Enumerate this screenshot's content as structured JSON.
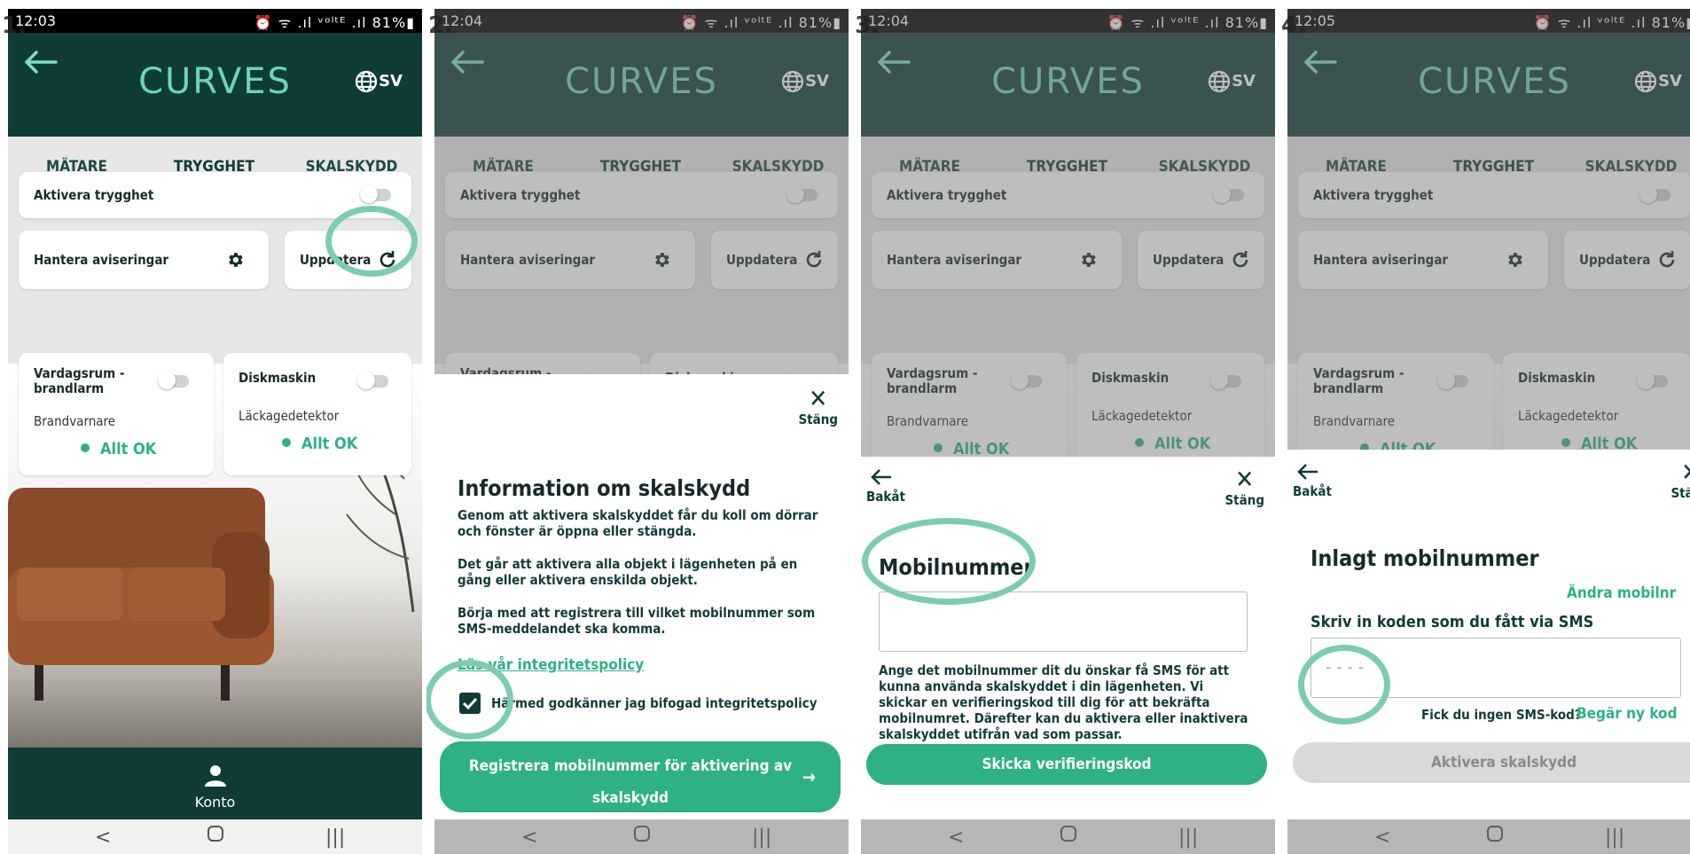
{
  "steps": [
    {
      "number": "1.",
      "time": "12:03"
    },
    {
      "number": "2.",
      "time": "12:04"
    },
    {
      "number": "3.",
      "time": "12:04"
    },
    {
      "number": "4.",
      "time": "12:05"
    }
  ],
  "status_bar": {
    "icons": "⏰ ᯤ .ıl ᵛᵒˡᵗᴱ .ıl",
    "battery": "81%"
  },
  "app": {
    "logo": "CURVES",
    "language": "SV"
  },
  "tabs": [
    "MÄTARE",
    "TRYGGHET",
    "SKALSKYDD"
  ],
  "cards": {
    "activate_label": "Aktivera trygghet",
    "notifications_label": "Hantera aviseringar",
    "update_label": "Uppdatera",
    "device1_name": "Vardagsrum -\nbrandlarm",
    "device1_type": "Brandvarnare",
    "device1_status": "Allt OK",
    "device2_name": "Diskmaskin",
    "device2_type": "Läckagedetektor",
    "device2_status": "Allt OK"
  },
  "bottom_nav": {
    "account_label": "Konto"
  },
  "sheet2": {
    "close_label": "Stäng",
    "title": "Information om skalskydd",
    "p1": "Genom att aktivera skalskyddet får du koll om dörrar och fönster är öppna eller stängda.",
    "p2": "Det går att aktivera alla objekt i lägenheten på en gång eller aktivera enskilda objekt.",
    "p3": "Börja med att registrera till vilket mobilnummer som SMS-meddelandet ska komma.",
    "privacy_link": "Läs vår integritetspolicy",
    "consent_label": "Härmed godkänner jag bifogad integritetspolicy",
    "register_button": "Registrera mobilnummer för aktivering av skalskydd"
  },
  "sheet3": {
    "back_label": "Bakåt",
    "close_label": "Stäng",
    "title": "Mobilnummer",
    "input_value": "",
    "help_text": "Ange det mobilnummer dit du önskar få SMS för att kunna använda skalskyddet i din lägenheten. Vi skickar en verifieringskod till dig för att bekräfta mobilnumret. Därefter kan du aktivera eller inaktivera skalskyddet utifrån vad som passar.",
    "send_button": "Skicka verifieringskod"
  },
  "sheet4": {
    "back_label": "Bakåt",
    "close_label": "Stäng",
    "title": "Inlagt mobilnummer",
    "change_link": "Ändra mobilnr",
    "code_label": "Skriv in koden som du fått via SMS",
    "code_placeholder": "- - - -",
    "no_code_text": "Fick du ingen SMS-kod?",
    "resend_link": "Begär ny kod",
    "activate_button": "Aktivera skalskydd"
  },
  "colors": {
    "header": "#0f3c37",
    "accent": "#2eb183",
    "logo": "#71d4b7",
    "highlight": "#7cccb1"
  }
}
